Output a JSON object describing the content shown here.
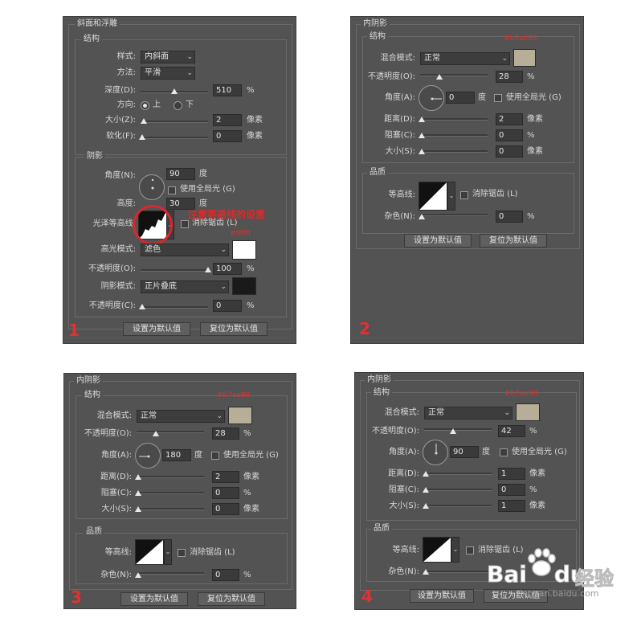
{
  "p1": {
    "title": "斜面和浮雕",
    "struct": "结构",
    "style_l": "样式:",
    "style_v": "内斜面",
    "method_l": "方法:",
    "method_v": "平滑",
    "depth_l": "深度(D):",
    "depth_v": "510",
    "pct": "%",
    "dir_l": "方向:",
    "dir_up": "上",
    "dir_down": "下",
    "size_l": "大小(Z):",
    "size_v": "2",
    "px": "像素",
    "soften_l": "软化(F):",
    "soften_v": "0",
    "shadow": "阴影",
    "angle_l": "角度(N):",
    "angle_v": "90",
    "deg": "度",
    "global": "使用全局光 (G)",
    "alt_l": "高度:",
    "alt_v": "30",
    "gloss_l": "光泽等高线:",
    "anti": "消除锯齿 (L)",
    "annot": "注意等高线的设置",
    "hl_color": "#ffffff",
    "hl_l": "高光模式:",
    "hl_v": "滤色",
    "op1_l": "不透明度(O):",
    "op1_v": "100",
    "sh_l": "阴影模式:",
    "sh_v": "正片叠底",
    "sh_color": "#1a1a1a",
    "op2_l": "不透明度(C):",
    "op2_v": "0",
    "btn_default": "设置为默认值",
    "btn_reset": "复位为默认值",
    "num": "1"
  },
  "p2": {
    "title": "内阴影",
    "struct": "结构",
    "hex": "#b7ae98",
    "blend_l": "混合模式:",
    "blend_v": "正常",
    "swatch": "#b7ae98",
    "op_l": "不透明度(O):",
    "op_v": "28",
    "pct": "%",
    "angle_l": "角度(A):",
    "angle_v": "0",
    "deg": "度",
    "global": "使用全局光 (G)",
    "dist_l": "距离(D):",
    "dist_v": "2",
    "px": "像素",
    "choke_l": "阻塞(C):",
    "choke_v": "0",
    "size_l": "大小(S):",
    "size_v": "0",
    "quality": "品质",
    "contour_l": "等高线:",
    "anti": "消除锯齿 (L)",
    "noise_l": "杂色(N):",
    "noise_v": "0",
    "btn_default": "设置为默认值",
    "btn_reset": "复位为默认值",
    "num": "2"
  },
  "p3": {
    "title": "内阴影",
    "struct": "结构",
    "hex": "#b7ae98",
    "blend_l": "混合模式:",
    "blend_v": "正常",
    "swatch": "#b7ae98",
    "op_l": "不透明度(O):",
    "op_v": "28",
    "pct": "%",
    "angle_l": "角度(A):",
    "angle_v": "180",
    "deg": "度",
    "global": "使用全局光 (G)",
    "dist_l": "距离(D):",
    "dist_v": "2",
    "px": "像素",
    "choke_l": "阻塞(C):",
    "choke_v": "0",
    "size_l": "大小(S):",
    "size_v": "0",
    "quality": "品质",
    "contour_l": "等高线:",
    "anti": "消除锯齿 (L)",
    "noise_l": "杂色(N):",
    "noise_v": "0",
    "btn_default": "设置为默认值",
    "btn_reset": "复位为默认值",
    "num": "3"
  },
  "p4": {
    "title": "内阴影",
    "struct": "结构",
    "hex": "#b7ae98",
    "blend_l": "混合模式:",
    "blend_v": "正常",
    "swatch": "#b7ae98",
    "op_l": "不透明度(O):",
    "op_v": "42",
    "pct": "%",
    "angle_l": "角度(A):",
    "angle_v": "90",
    "deg": "度",
    "global": "使用全局光 (G)",
    "dist_l": "距离(D):",
    "dist_v": "1",
    "px": "像素",
    "choke_l": "阻塞(C):",
    "choke_v": "0",
    "size_l": "大小(S):",
    "size_v": "1",
    "quality": "品质",
    "contour_l": "等高线:",
    "anti": "消除锯齿 (L)",
    "noise_l": "杂色(N):",
    "btn_default": "设置为默认值",
    "btn_reset": "复位为默认值",
    "num": "4"
  },
  "watermark": {
    "brand": "Bai",
    "brand2": "du",
    "jingyan": "经验",
    "url": "jingyan.baidu.com"
  },
  "sliders": {
    "depth": 0.5,
    "p1_size": 0.02,
    "p1_soften": 0,
    "p1_op1": 1.0,
    "p1_op2": 0,
    "p2_op": 0.28,
    "p3_op": 0.28,
    "p4_op": 0.42
  }
}
